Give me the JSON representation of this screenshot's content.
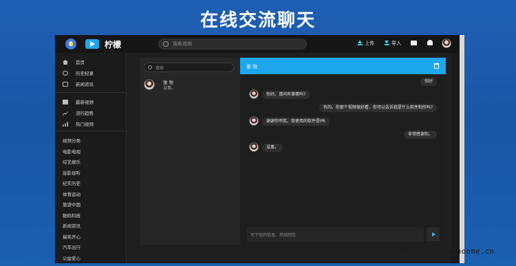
{
  "banner": {
    "title": "在线交流聊天"
  },
  "topbar": {
    "logo_text": "柠檬",
    "search_placeholder": "搜索视频",
    "upload_label": "上传",
    "import_label": "导入",
    "icons": [
      "menu-icon",
      "play-logo-icon",
      "search-icon",
      "upload-icon",
      "import-icon",
      "message-icon",
      "bell-icon",
      "avatar"
    ]
  },
  "sidebar": {
    "group1": [
      "首页",
      "历史纪录",
      "新闻资讯"
    ],
    "group2": [
      "最新视频",
      "流行趋势",
      "热门视频"
    ],
    "categories": [
      "视频分类",
      "电影电视",
      "综艺娱乐",
      "音影视听",
      "纪实历史",
      "体育运动",
      "旅游中国",
      "数码科技",
      "新闻资讯",
      "搞笑开心",
      "汽车出行",
      "公益爱心"
    ]
  },
  "contacts": {
    "search_placeholder": "搜索",
    "items": [
      {
        "name": "张 怡",
        "last_message": "没事。"
      }
    ]
  },
  "chat": {
    "title": "张 怡",
    "messages": [
      {
        "side": "right",
        "text": "你好"
      },
      {
        "side": "left",
        "text": "你好。请问有事情吗?"
      },
      {
        "side": "right",
        "text": "有的。你那个视频很好看，你可以告诉我是什么软件制作吗?"
      },
      {
        "side": "left",
        "text": "谢谢你夸奖。我使用的软件是PR"
      },
      {
        "side": "right",
        "text": "非常感谢你。"
      },
      {
        "side": "left",
        "text": "没事。"
      }
    ],
    "input_placeholder": "写下你的信息，然后回车"
  },
  "watermark": "https://www.noome.cn",
  "colors": {
    "accent": "#1da8ee",
    "background": "#1a56a6",
    "app_bg": "#1f1f1f"
  }
}
